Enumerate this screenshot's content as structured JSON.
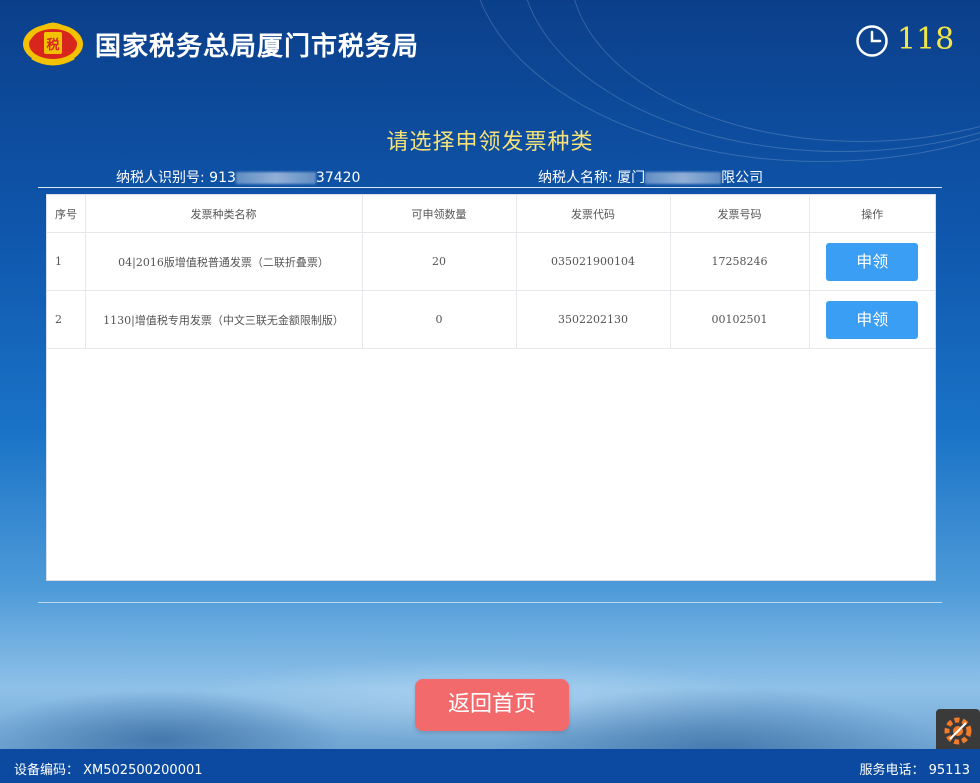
{
  "header": {
    "org_title": "国家税务总局厦门市税务局",
    "countdown": "118"
  },
  "page_heading": "请选择申领发票种类",
  "taxpayer": {
    "id_label": "纳税人识别号:",
    "id_prefix": "913",
    "id_suffix": "37420",
    "name_label": "纳税人名称:",
    "name_prefix": "厦门",
    "name_suffix": "限公司"
  },
  "table": {
    "columns": [
      "序号",
      "发票种类名称",
      "可申领数量",
      "发票代码",
      "发票号码",
      "操作"
    ],
    "rows": [
      {
        "index": "1",
        "type": "04|2016版增值税普通发票（二联折叠票）",
        "quantity": "20",
        "code": "035021900104",
        "number": "17258246",
        "action": "申领"
      },
      {
        "index": "2",
        "type": "1130|增值税专用发票（中文三联无金额限制版）",
        "quantity": "0",
        "code": "3502202130",
        "number": "00102501",
        "action": "申领"
      }
    ]
  },
  "back_button": "返回首页",
  "footer": {
    "device_code": "设备编码： XM502500200001",
    "service_phone": "服务电话： 95113"
  },
  "colors": {
    "accent_button": "#3a9ef5",
    "back_button": "#f36a6d",
    "heading": "#f5e27a",
    "countdown": "#f3e64a"
  }
}
